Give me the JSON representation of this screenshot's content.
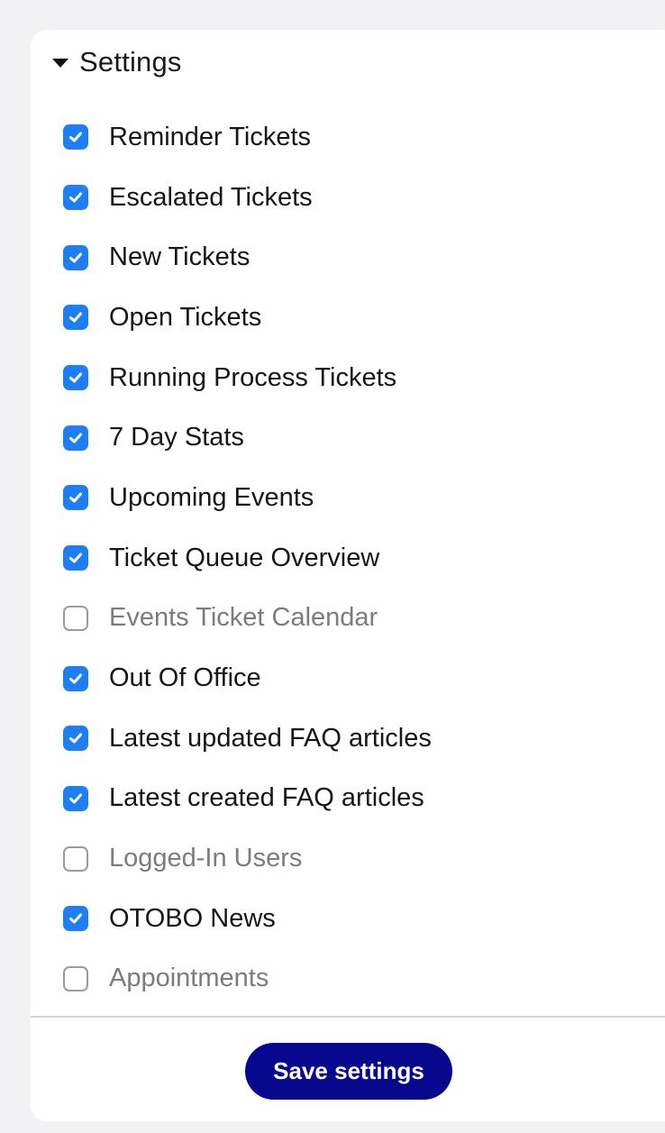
{
  "section": {
    "title": "Settings",
    "expanded": true
  },
  "colors": {
    "checkbox_checked": "#1e7ef5",
    "button_bg": "#08088f",
    "background": "#f2f2f4",
    "panel": "#ffffff"
  },
  "icons": {
    "caret": "caret-down-icon",
    "check": "checkmark-icon"
  },
  "items": [
    {
      "label": "Reminder Tickets",
      "checked": true
    },
    {
      "label": "Escalated Tickets",
      "checked": true
    },
    {
      "label": "New Tickets",
      "checked": true
    },
    {
      "label": "Open Tickets",
      "checked": true
    },
    {
      "label": "Running Process Tickets",
      "checked": true
    },
    {
      "label": "7 Day Stats",
      "checked": true
    },
    {
      "label": "Upcoming Events",
      "checked": true
    },
    {
      "label": "Ticket Queue Overview",
      "checked": true
    },
    {
      "label": "Events Ticket Calendar",
      "checked": false
    },
    {
      "label": "Out Of Office",
      "checked": true
    },
    {
      "label": "Latest updated FAQ articles",
      "checked": true
    },
    {
      "label": "Latest created FAQ articles",
      "checked": true
    },
    {
      "label": "Logged-In Users",
      "checked": false
    },
    {
      "label": "OTOBO News",
      "checked": true
    },
    {
      "label": "Appointments",
      "checked": false
    }
  ],
  "save_button": {
    "label": "Save settings"
  }
}
